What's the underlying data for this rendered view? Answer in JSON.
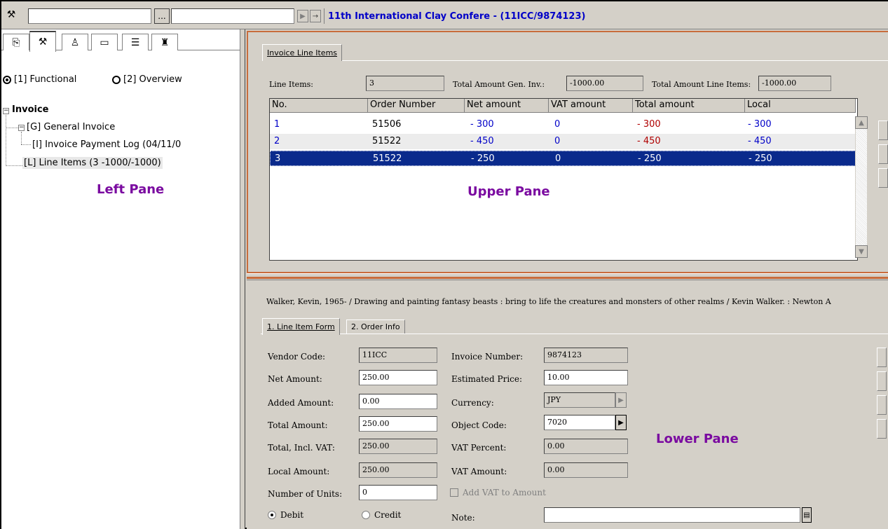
{
  "toolbar": {
    "record_title": "11th International Clay Confere - (11ICC/9874123)",
    "browse_button": "...",
    "icons": [
      "wand-icon",
      "play-icon",
      "go-arrow-icon"
    ]
  },
  "left_pane": {
    "tabs": [
      "doc-icon",
      "wand-icon",
      "trash-icon",
      "folder-icon",
      "list-icon",
      "binoculars-icon"
    ],
    "view_options": [
      {
        "label": "[1] Functional",
        "checked": true
      },
      {
        "label": "[2] Overview",
        "checked": false
      }
    ],
    "tree": {
      "root": "Invoice",
      "root_toggle": "−",
      "child_toggle": "−",
      "general": "[G] General Invoice",
      "payment_log": "[I] Invoice Payment Log (04/11/0",
      "line_items": "[L] Line Items (3 -1000/-1000)"
    },
    "annotation": "Left Pane"
  },
  "upper_pane": {
    "tab": "Invoice Line Items",
    "summary": {
      "line_items_label": "Line Items:",
      "line_items_value": "3",
      "total_gen_label": "Total Amount Gen. Inv.:",
      "total_gen_value": "-1000.00",
      "total_line_label": "Total Amount Line Items:",
      "total_line_value": "-1000.00"
    },
    "grid": {
      "columns": [
        "No.",
        "Order Number",
        "Net amount",
        "VAT amount",
        "Total amount",
        "Local"
      ],
      "rows": [
        {
          "no": "1",
          "order": "51506",
          "net": "- 300",
          "vat": "0",
          "total": "- 300",
          "local": "- 300"
        },
        {
          "no": "2",
          "order": "51522",
          "net": "- 450",
          "vat": "0",
          "total": "- 450",
          "local": "- 450"
        },
        {
          "no": "3",
          "order": "51522",
          "net": "- 250",
          "vat": "0",
          "total": "- 250",
          "local": "- 250"
        }
      ],
      "scroll_up": "▲",
      "scroll_down": "▼"
    },
    "annotation": "Upper Pane"
  },
  "lower_pane": {
    "citation": "Walker, Kevin, 1965- / Drawing and painting fantasy beasts : bring to life the creatures and monsters of other realms / Kevin Walker. :   Newton A",
    "tabs": [
      "1. Line Item Form",
      "2. Order Info"
    ],
    "form": {
      "vendor_code_label": "Vendor Code:",
      "vendor_code": "11ICC",
      "net_amount_label": "Net Amount:",
      "net_amount": "250.00",
      "added_amount_label": "Added Amount:",
      "added_amount": "0.00",
      "total_amount_label": "Total Amount:",
      "total_amount": "250.00",
      "total_incl_vat_label": "Total, Incl. VAT:",
      "total_incl_vat": "250.00",
      "local_amount_label": "Local Amount:",
      "local_amount": "250.00",
      "units_label": "Number of Units:",
      "units": "0",
      "debit_label": "Debit",
      "credit_label": "Credit",
      "invoice_number_label": "Invoice Number:",
      "invoice_number": "9874123",
      "estimated_price_label": "Estimated Price:",
      "estimated_price": "10.00",
      "currency_label": "Currency:",
      "currency": "JPY",
      "object_code_label": "Object Code:",
      "object_code": "7020",
      "vat_percent_label": "VAT Percent:",
      "vat_percent": "0.00",
      "vat_amount_label": "VAT Amount:",
      "vat_amount": "0.00",
      "add_vat_label": "Add VAT to Amount",
      "note_label": "Note:",
      "note": ""
    },
    "annotation": "Lower Pane"
  },
  "colors": {
    "title_blue": "#0000c8",
    "annotation_purple": "#7a0aa0",
    "selected_row": "#0a2a8c",
    "pane_border": "#c86c3c",
    "negative_red": "#b00000"
  }
}
